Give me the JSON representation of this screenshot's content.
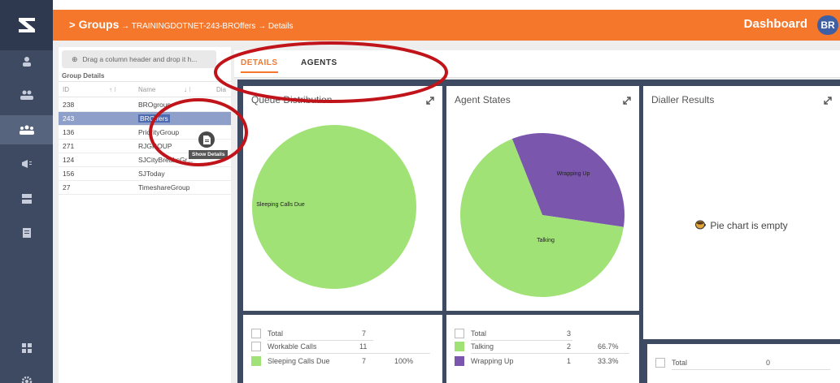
{
  "header": {
    "breadcrumb_main": "Groups",
    "breadcrumb_rest": "→ TRAININGDOTNET-243-BROffers → Details",
    "dashboard_label": "Dashboard",
    "avatar_initials": "BR"
  },
  "grid": {
    "drag_hint": "Drag a column header and drop it h...",
    "title": "Group Details",
    "columns": [
      "ID",
      "Name",
      "Dia"
    ],
    "rows": [
      {
        "id": "238",
        "name": "BROgroup"
      },
      {
        "id": "243",
        "name": "BROffers"
      },
      {
        "id": "136",
        "name": "PriorityGroup"
      },
      {
        "id": "271",
        "name": "RJGROUP"
      },
      {
        "id": "124",
        "name": "SJCityBreaksGr..."
      },
      {
        "id": "156",
        "name": "SJToday"
      },
      {
        "id": "27",
        "name": "TimeshareGroup"
      }
    ],
    "selected_row": 1,
    "tooltip": "Show Details"
  },
  "tabs": [
    {
      "label": "DETAILS",
      "active": true
    },
    {
      "label": "AGENTS",
      "active": false
    }
  ],
  "cards": {
    "queue": {
      "title": "Queue Distribution",
      "slice_label": "Sleeping Calls Due",
      "stats": [
        {
          "label": "Total",
          "value": "7",
          "pct": ""
        },
        {
          "label": "Workable Calls",
          "value": "11",
          "pct": ""
        },
        {
          "label": "Sleeping Calls Due",
          "value": "7",
          "pct": "100%"
        }
      ]
    },
    "agents": {
      "title": "Agent States",
      "slice_labels": [
        "Wrapping Up",
        "Talking"
      ],
      "stats": [
        {
          "label": "Total",
          "value": "3",
          "pct": ""
        },
        {
          "label": "Talking",
          "value": "2",
          "pct": "66.7%"
        },
        {
          "label": "Wrapping Up",
          "value": "1",
          "pct": "33.3%"
        }
      ]
    },
    "dialler": {
      "title": "Dialler Results",
      "empty_text": "Pie chart is empty",
      "stats": [
        {
          "label": "Total",
          "value": "0"
        }
      ]
    }
  },
  "colors": {
    "accent": "#f5772b",
    "sidebar": "#3d4a62",
    "pie_green": "#a0e276",
    "pie_purple": "#7a56ad"
  },
  "icons": [
    "logo-icon",
    "user-icon",
    "users-icon",
    "groups-icon",
    "megaphone-icon",
    "list-icon",
    "document-icon",
    "grid-icon",
    "settings-icon",
    "expand-icon"
  ],
  "chart_data": [
    {
      "type": "pie",
      "title": "Queue Distribution",
      "categories": [
        "Sleeping Calls Due"
      ],
      "values": [
        7
      ]
    },
    {
      "type": "pie",
      "title": "Agent States",
      "categories": [
        "Talking",
        "Wrapping Up"
      ],
      "values": [
        2,
        1
      ]
    },
    {
      "type": "pie",
      "title": "Dialler Results",
      "categories": [],
      "values": []
    }
  ]
}
